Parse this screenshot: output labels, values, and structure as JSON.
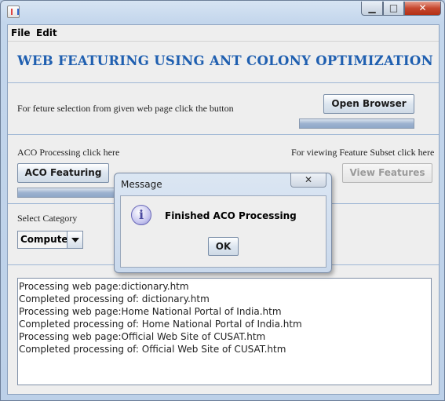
{
  "window": {
    "title": "",
    "controls": {
      "minimize": "▁",
      "maximize": "□",
      "close": "✕"
    }
  },
  "menu": {
    "items": [
      "File",
      "Edit"
    ]
  },
  "header": {
    "title": "WEB FEATURING USING ANT COLONY OPTIMIZATION"
  },
  "browser_section": {
    "instruction": "For feture selection from given web page click the button",
    "button_label": "Open Browser",
    "progress": 0
  },
  "aco_section": {
    "left_label": "ACO Processing click here",
    "aco_button_label": "ACO Featuring",
    "right_label": "For viewing Feature Subset click here",
    "view_button_label": "View Features",
    "view_button_enabled": false,
    "progress": 0
  },
  "category_section": {
    "label": "Select Category",
    "selected": "Computer"
  },
  "log": {
    "lines": [
      "Processing web page:dictionary.htm",
      "Completed processing of: dictionary.htm",
      "Processing web page:Home  National Portal of India.htm",
      "Completed processing of: Home  National Portal of India.htm",
      "Processing web page:Official Web Site of CUSAT.htm",
      "Completed processing of: Official Web Site of CUSAT.htm"
    ]
  },
  "dialog": {
    "title": "Message",
    "close": "✕",
    "icon": "info-icon",
    "icon_glyph": "i",
    "message": "Finished ACO Processing",
    "ok_label": "OK"
  },
  "colors": {
    "heading": "#1f5fb0",
    "window_frame": "#c3d6ec",
    "progress_fill": "#9db2cf",
    "close_button": "#c6472f"
  }
}
